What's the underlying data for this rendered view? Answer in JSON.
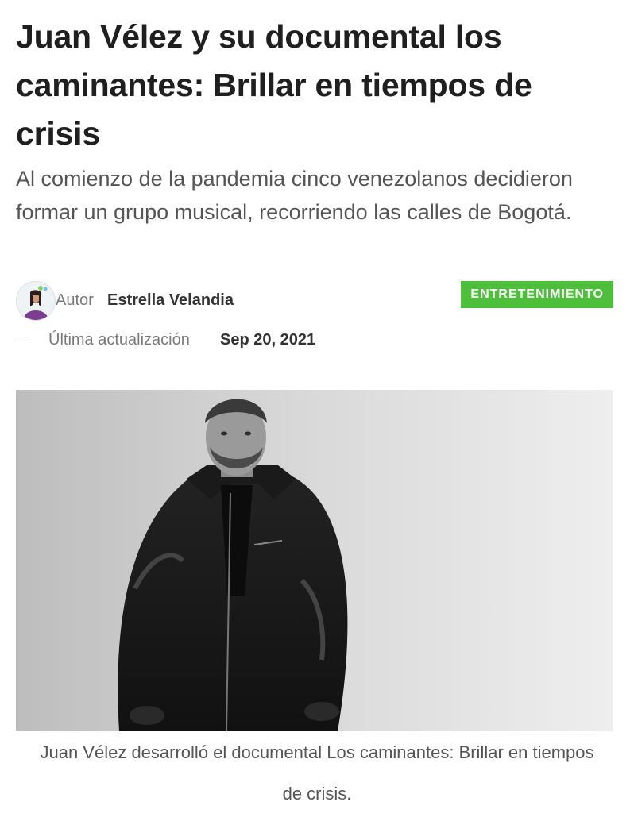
{
  "article": {
    "title": "Juan Vélez y su documental los caminantes: Brillar en tiempos de crisis",
    "subtitle": "Al comienzo de la pandemia cinco venezolanos decidieron formar un grupo musical, recorriendo las calles de Bogotá.",
    "author_label": "Autor",
    "author_name": "Estrella Velandia",
    "category": "ENTRETENIMIENTO",
    "updated_label": "Última actualización",
    "updated_date": "Sep 20, 2021",
    "image_caption": "Juan Vélez desarrolló el documental Los caminantes: Brillar en tiempos de crisis."
  },
  "colors": {
    "category_badge": "#4dbf3a",
    "title_text": "#1f1f1f",
    "subtitle_text": "#555555"
  },
  "icons": {
    "author_avatar": "avatar",
    "hero_photo": "black-and-white portrait"
  }
}
